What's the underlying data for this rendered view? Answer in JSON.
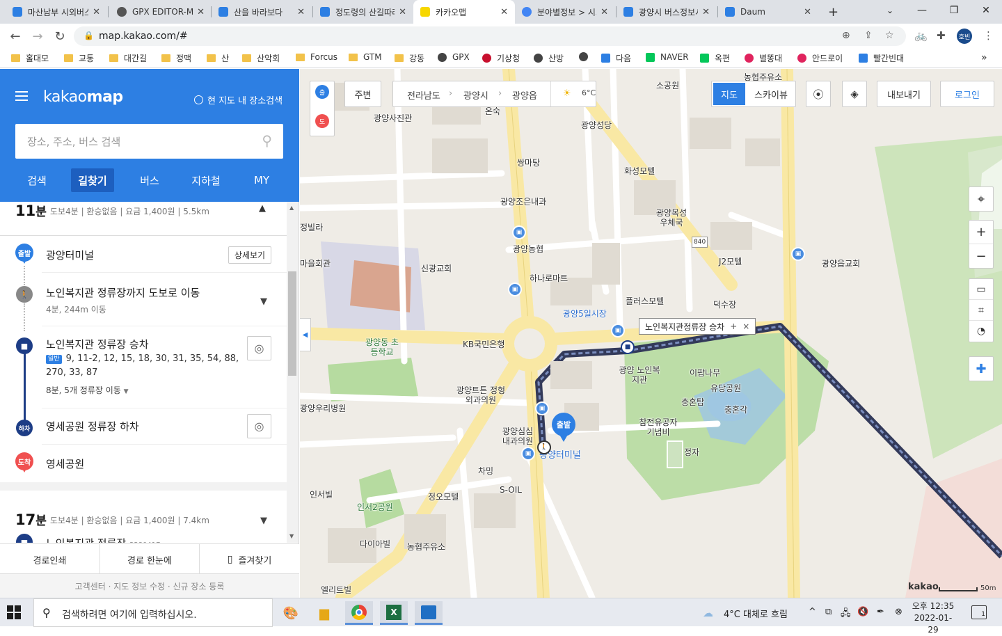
{
  "browser": {
    "tabs": [
      {
        "title": "마산남부 시외버스터미널",
        "favicon_color": "#2d7fe3"
      },
      {
        "title": "GPX EDITOR-MAP",
        "favicon_color": "#555555"
      },
      {
        "title": "산을 바라보다",
        "favicon_color": "#2d7fe3"
      },
      {
        "title": "정도령의 산길따라",
        "favicon_color": "#2d7fe3"
      },
      {
        "title": "카카오맵",
        "favicon_color": "#f7d700"
      },
      {
        "title": "분야별정보 > 시외",
        "favicon_color": "#4285f4"
      },
      {
        "title": "광양시 버스정보시스템",
        "favicon_color": "#2d7fe3"
      },
      {
        "title": "Daum",
        "favicon_color": "#2d7fe3"
      }
    ],
    "new_tab": "+",
    "url": "map.kakao.com/#",
    "profile_initial": "호빈",
    "bookmarks": [
      {
        "label": "홀대모",
        "kind": "folder"
      },
      {
        "label": "교통",
        "kind": "folder"
      },
      {
        "label": "대간길",
        "kind": "folder"
      },
      {
        "label": "정맥",
        "kind": "folder"
      },
      {
        "label": "산",
        "kind": "folder"
      },
      {
        "label": "산악회",
        "kind": "folder"
      },
      {
        "label": "Forcus",
        "kind": "folder"
      },
      {
        "label": "GTM",
        "kind": "folder"
      },
      {
        "label": "강동",
        "kind": "folder"
      },
      {
        "label": "GPX",
        "kind": "site",
        "color": "#444444"
      },
      {
        "label": "기상청",
        "kind": "site",
        "color": "#c8102e"
      },
      {
        "label": "산방",
        "kind": "site",
        "color": "#444444"
      },
      {
        "label": "",
        "kind": "site",
        "color": "#444444"
      },
      {
        "label": "다음",
        "kind": "site",
        "color": "#2d7fe3"
      },
      {
        "label": "NAVER",
        "kind": "site",
        "color": "#03c75a"
      },
      {
        "label": "옥편",
        "kind": "site",
        "color": "#03c75a"
      },
      {
        "label": "별똥대",
        "kind": "site",
        "color": "#e0245e"
      },
      {
        "label": "안드로이",
        "kind": "site",
        "color": "#e0245e"
      },
      {
        "label": "빨간빈대",
        "kind": "site",
        "color": "#2d7fe3"
      }
    ],
    "more_bookmarks": "»"
  },
  "kakaomap": {
    "logo_a": "kakao",
    "logo_b": "map",
    "current_area_search": "현 지도 내 장소검색",
    "search_placeholder": "장소, 주소, 버스 검색",
    "tabs": [
      "검색",
      "길찾기",
      "버스",
      "지하철",
      "MY"
    ],
    "active_tab": "길찾기",
    "route1": {
      "time_num": "11",
      "time_unit": "분",
      "info": "도보4분 | 환승없음 | 요금 1,400원 | 5.5km",
      "start": "광양터미널",
      "start_badge": "출발",
      "detail_button": "상세보기",
      "walk_title": "노인복지관 정류장까지 도보로 이동",
      "walk_sub": "4분, 244m 이동",
      "board_title": "노인복지관 정류장 승차",
      "bus_badge": "일반",
      "bus_numbers_line1": "9, 11-2, 12, 15, 18, 30, 31, 35, 54, 88,",
      "bus_numbers_line2": "270, 33, 87",
      "ride_info": "8분, 5개 정류장 이동",
      "alight_title": "영세공원 정류장 하차",
      "alight_badge": "하차",
      "end": "영세공원",
      "end_badge": "도착"
    },
    "route2": {
      "time_num": "17",
      "time_unit": "분",
      "info": "도보4분 | 환승없음 | 요금 1,400원 | 7.4km",
      "partial": "노인복지관 정류장",
      "partial_code": "3280417"
    },
    "footer": {
      "print": "경로인쇄",
      "overview": "경로 한눈에",
      "favorite": "즐겨찾기"
    },
    "copyright": "고객센터 · 지도 정보 수정 · 신규 장소 등록"
  },
  "map": {
    "nearby": "주변",
    "crumbs": [
      "전라남도",
      "광양시",
      "광양읍"
    ],
    "weather": "6°C",
    "map_mode": "지도",
    "sky_mode": "스카이뷰",
    "export": "내보내기",
    "login": "로그인",
    "start_marker": "출발",
    "end_marker": "도",
    "origin_marker_top": "출",
    "tooltip": "노인복지관정류장 승차",
    "tooltip_plus": "+",
    "tooltip_close": "×",
    "road_840": "840",
    "scale": "50m",
    "brand": "kakao",
    "labels": [
      "광양사진관",
      "온숙",
      "광양성당",
      "소공원",
      "농협주유소",
      "쌍마탕",
      "화성모텔",
      "광양조은내과",
      "광양목성 우체국",
      "J2모텔",
      "광양읍교회",
      "정빌라",
      "마을회관",
      "신광교회",
      "광양농협",
      "하나로마트",
      "플러스모텔",
      "덕수장",
      "광양5일시장",
      "광양동 초등학교",
      "KB국민은행",
      "광양 노인복지관",
      "이팝나무",
      "유당공원",
      "충혼탑",
      "충혼각",
      "광양트튼 정형외과의원",
      "광양우리병원",
      "참전유공자 기념비",
      "정자",
      "광양심심 내과의원",
      "광양터미널",
      "차밍",
      "인서빌",
      "인서2공원",
      "정오모텔",
      "S-OIL",
      "다이아빌",
      "농협주유소",
      "엘리트빌"
    ]
  },
  "taskbar": {
    "search_text": "검색하려면 여기에 입력하십시오.",
    "weather": "4°C  대체로 흐림",
    "time": "오후 12:35",
    "date": "2022-01-29",
    "notif_count": "1"
  }
}
